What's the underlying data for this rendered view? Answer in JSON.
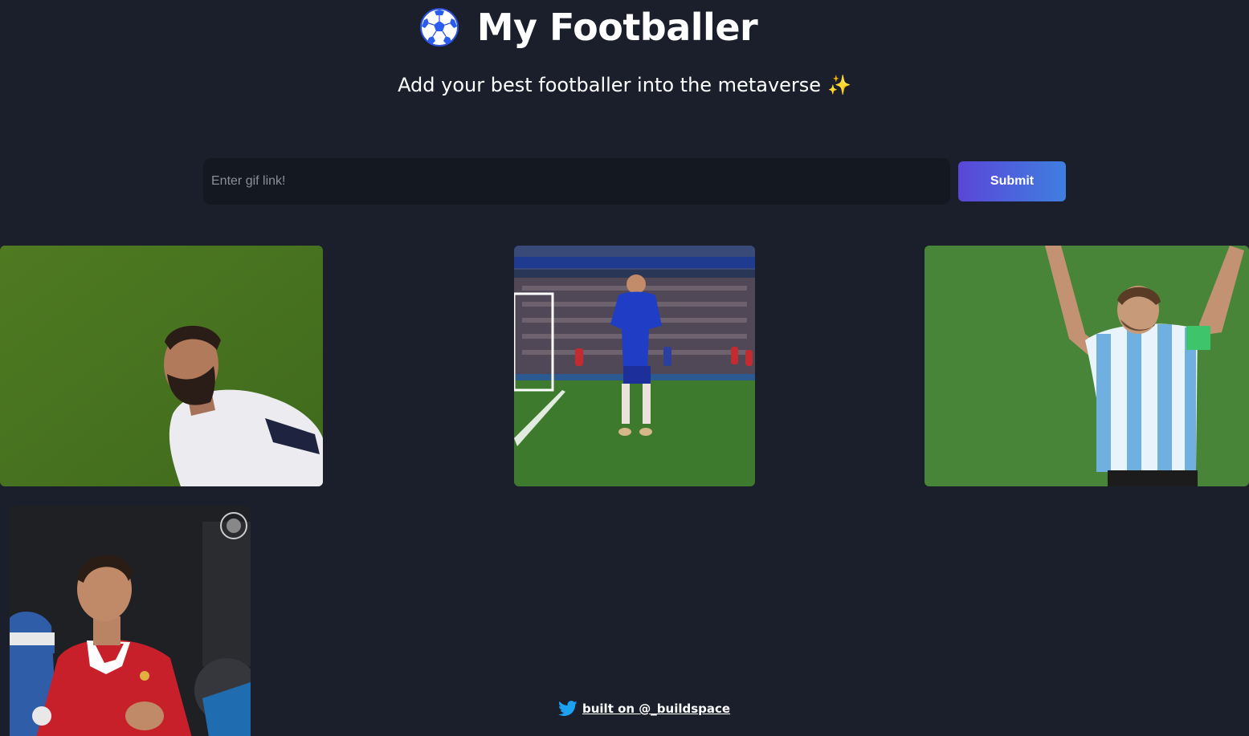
{
  "header": {
    "icon": "soccer-ball-icon",
    "title": "My Footballer",
    "subtitle": "Add your best footballer into the metaverse",
    "subtitle_icon": "sparkles-icon"
  },
  "form": {
    "input_value": "",
    "input_placeholder": "Enter gif link!",
    "submit_label": "Submit"
  },
  "gifs": [
    {
      "subject": "footballer-celebrating-white-kit"
    },
    {
      "subject": "footballer-running-blue-kit"
    },
    {
      "subject": "footballer-arms-raised-striped-kit"
    },
    {
      "subject": "footballer-hands-together-red-kit"
    }
  ],
  "footer": {
    "icon": "twitter-icon",
    "link_text": "built on @_buildspace"
  },
  "colors": {
    "background": "#1a1f2b",
    "input_bg": "#141821",
    "button_gradient_start": "#5a46d8",
    "button_gradient_end": "#3f7fe0",
    "twitter_blue": "#1da1f2"
  }
}
